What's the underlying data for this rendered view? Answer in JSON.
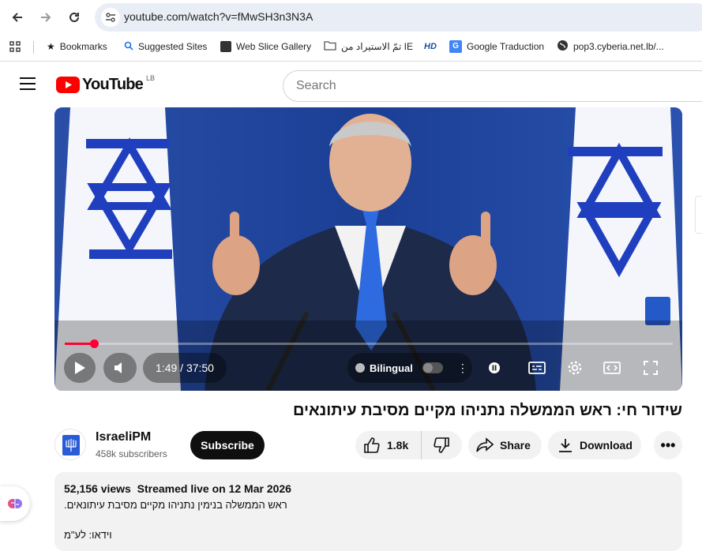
{
  "browser": {
    "url": "youtube.com/watch?v=fMwSH3n3N3A",
    "bookmarks": [
      {
        "label": "Bookmarks",
        "icon": "star-icon"
      },
      {
        "label": "Suggested Sites",
        "icon": "search-icon"
      },
      {
        "label": "Web Slice Gallery",
        "icon": "web-slice-icon"
      },
      {
        "label": "تمّ الاستيراد من IE",
        "icon": "folder-icon"
      },
      {
        "label": "HD",
        "icon": "hd-icon"
      },
      {
        "label": "Google Traduction",
        "icon": "translate-icon"
      },
      {
        "label": "pop3.cyberia.net.lb/...",
        "icon": "globe-icon"
      }
    ]
  },
  "header": {
    "logo_text": "YouTube",
    "country_code": "LB",
    "search_placeholder": "Search"
  },
  "player": {
    "time_current": "1:49",
    "time_sep": " / ",
    "time_total": "37:50",
    "progress": 0.048,
    "bilingual_label": "Bilingual",
    "accent_color": "#ff0033"
  },
  "video": {
    "title": "שידור חי: ראש הממשלה נתניהו מקיים מסיבת עיתונאים",
    "channel_name": "IsraeliPM",
    "subscribers": "458k subscribers",
    "subscribe_label": "Subscribe",
    "likes": "1.8k",
    "share_label": "Share",
    "download_label": "Download"
  },
  "description": {
    "views": "52,156 views",
    "streamed": "Streamed live on 12 Mar 2026",
    "line1": "ראש הממשלה בנימין נתניהו מקיים מסיבת עיתונאים.",
    "line2": "וידאו: לע\"מ"
  }
}
